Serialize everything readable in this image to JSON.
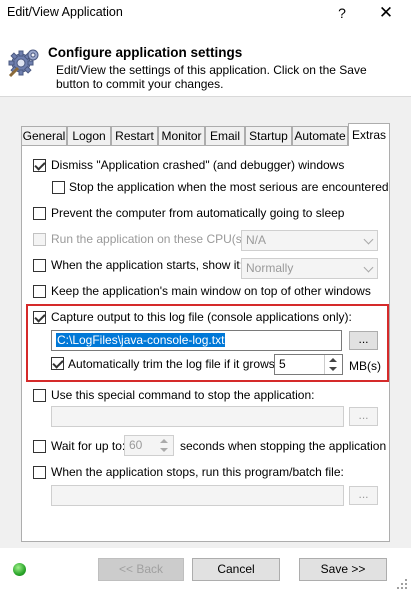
{
  "window": {
    "title": "Edit/View Application",
    "help_label": "?",
    "close_label": "✕"
  },
  "header": {
    "title": "Configure application settings",
    "description": "Edit/View the settings of this application. Click on the Save button to commit your changes."
  },
  "tabs": [
    {
      "label": "General"
    },
    {
      "label": "Logon"
    },
    {
      "label": "Restart"
    },
    {
      "label": "Monitor"
    },
    {
      "label": "Email"
    },
    {
      "label": "Startup"
    },
    {
      "label": "Automate"
    },
    {
      "label": "Extras",
      "active": true
    }
  ],
  "extras": {
    "dismiss_crash": {
      "label": "Dismiss \"Application crashed\" (and debugger) windows",
      "checked": true
    },
    "stop_serious": {
      "label": "Stop the application when the most serious are encountered",
      "checked": false
    },
    "prevent_sleep": {
      "label": "Prevent the computer from automatically going to sleep",
      "checked": false
    },
    "cpus": {
      "label": "Run the application on these CPU(s):",
      "checked": false,
      "enabled": false,
      "value": "N/A"
    },
    "show_it": {
      "label": "When the application starts, show it:",
      "checked": false,
      "value": "Normally"
    },
    "keep_on_top": {
      "label": "Keep the application's main window on top of other windows",
      "checked": false
    },
    "capture_output": {
      "label": "Capture output to this log file (console applications only):",
      "checked": true,
      "path": "C:\\LogFiles\\java-console-log.txt"
    },
    "auto_trim": {
      "label": "Automatically trim the log file if it grows to",
      "checked": true,
      "value": "5",
      "unit": "MB(s)"
    },
    "special_command": {
      "label": "Use this special command to stop the application:",
      "checked": false,
      "value": ""
    },
    "wait_for": {
      "label": "Wait for up to:",
      "checked": false,
      "value": "60",
      "suffix": "seconds when stopping the application"
    },
    "run_program": {
      "label": "When the application stops, run this program/batch file:",
      "checked": false,
      "value": ""
    },
    "browse_label": "..."
  },
  "footer": {
    "back_label": "<< Back",
    "cancel_label": "Cancel",
    "save_label": "Save >>",
    "status_color": "#2aa52a"
  },
  "colors": {
    "highlight_border": "#d52a2a",
    "selection": "#0078d7"
  }
}
